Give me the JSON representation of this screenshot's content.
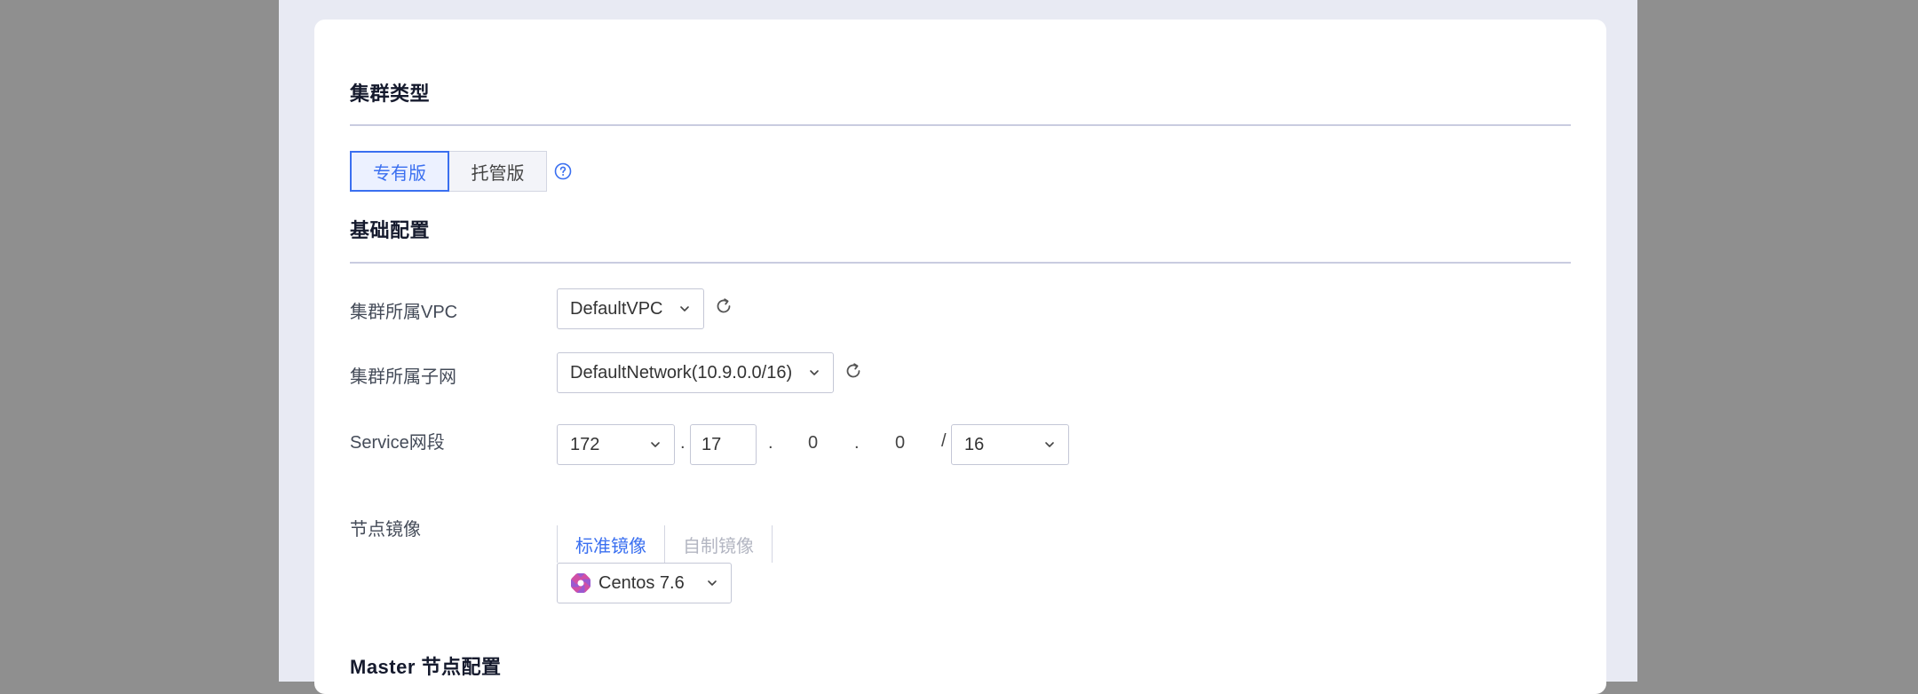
{
  "cluster_type": {
    "title": "集群类型",
    "options": [
      "专有版",
      "托管版"
    ],
    "selected": "专有版"
  },
  "basic_config": {
    "title": "基础配置",
    "vpc": {
      "label": "集群所属VPC",
      "value": "DefaultVPC"
    },
    "subnet": {
      "label": "集群所属子网",
      "value": "DefaultNetwork(10.9.0.0/16)"
    },
    "service_cidr": {
      "label": "Service网段",
      "octet1": "172",
      "octet2": "17",
      "octet3": "0",
      "octet4": "0",
      "dot": ".",
      "slash": "/",
      "mask": "16"
    },
    "node_image": {
      "label": "节点镜像",
      "tabs": [
        "标准镜像",
        "自制镜像"
      ],
      "selected_tab": "标准镜像",
      "os": "Centos 7.6",
      "os_icon": "centos-icon"
    }
  },
  "master_config": {
    "title": "Master 节点配置"
  },
  "colors": {
    "accent": "#3a6ff0",
    "page_bg": "#e8eaf3",
    "outer_bg": "#8f8f8f"
  }
}
